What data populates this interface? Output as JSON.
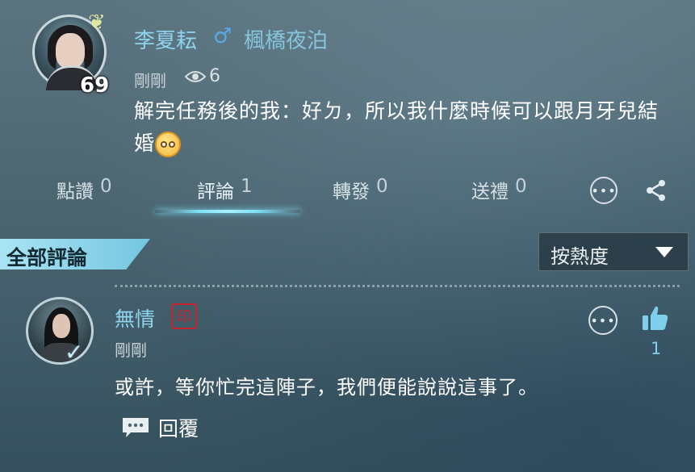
{
  "post": {
    "author": "李夏耘",
    "gender_symbol": "♂",
    "guild": "楓橋夜泊",
    "level": "69",
    "time": "剛剛",
    "views": "6",
    "text": "解完任務後的我：好ㄉ，所以我什麼時候可以跟月牙兒結婚",
    "emoji": "pleading-face-emoji"
  },
  "actions": {
    "like_label": "點讚",
    "like_count": "0",
    "comment_label": "評論",
    "comment_count": "1",
    "share_label": "轉發",
    "share_count": "0",
    "gift_label": "送禮",
    "gift_count": "0"
  },
  "comments_section": {
    "title": "全部評論",
    "sort_label": "按熱度"
  },
  "comment": {
    "author": "無情",
    "time": "剛剛",
    "text": "或許，等你忙完這陣子，我們便能說說這事了。",
    "like_count": "1",
    "reply_label": "回覆"
  },
  "colors": {
    "accent": "#8fd3ec",
    "gender": "#5aa8e6",
    "seal": "#c8232c"
  }
}
